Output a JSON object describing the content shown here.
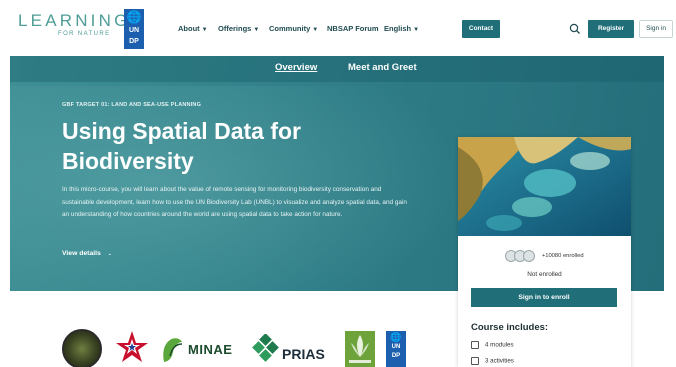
{
  "brand": {
    "logo_main": "LEARNING",
    "logo_sub": "FOR NATURE",
    "undp_line1": "UN",
    "undp_line2": "DP"
  },
  "nav": {
    "items": [
      {
        "label": "About",
        "has_caret": true
      },
      {
        "label": "Offerings",
        "has_caret": true
      },
      {
        "label": "Community",
        "has_caret": true
      },
      {
        "label": "NBSAP Forum",
        "has_caret": false
      },
      {
        "label": "English",
        "has_caret": true
      }
    ],
    "contact_label": "Contact",
    "register_label": "Register",
    "signin_label": "Sign in"
  },
  "subnav": {
    "tabs": [
      {
        "label": "Overview",
        "active": true
      },
      {
        "label": "Meet and Greet",
        "active": false
      }
    ]
  },
  "hero": {
    "eyebrow": "GBF TARGET 01: LAND AND SEA-USE PLANNING",
    "title": "Using Spatial Data for Biodiversity",
    "description": "In this micro-course, you will learn about the value of remote sensing for monitoring biodiversity conservation and sustainable development, learn how to use the UN Biodiversity Lab (UNBL) to visualize and analyze spatial data, and gain an understanding of how countries around the world are using spatial data to take action for nature.",
    "view_details": "View details"
  },
  "course_card": {
    "enrolled_count": "+10080 enrolled",
    "status": "Not enrolled",
    "enroll_button": "Sign in to enroll",
    "includes_title": "Course includes:",
    "includes": [
      {
        "icon": "book-icon",
        "text": "4 modules"
      },
      {
        "icon": "activity-icon",
        "text": "3 activities"
      }
    ]
  },
  "partners": {
    "minae_name": "MINAE",
    "prias_name": "PRIAS",
    "undp_line1": "UN",
    "undp_line2": "DP"
  },
  "colors": {
    "brand_teal": "#1f6e78",
    "hero_teal": "#2f7d87",
    "logo_teal": "#4f9d97",
    "undp_blue": "#1b5fae"
  }
}
